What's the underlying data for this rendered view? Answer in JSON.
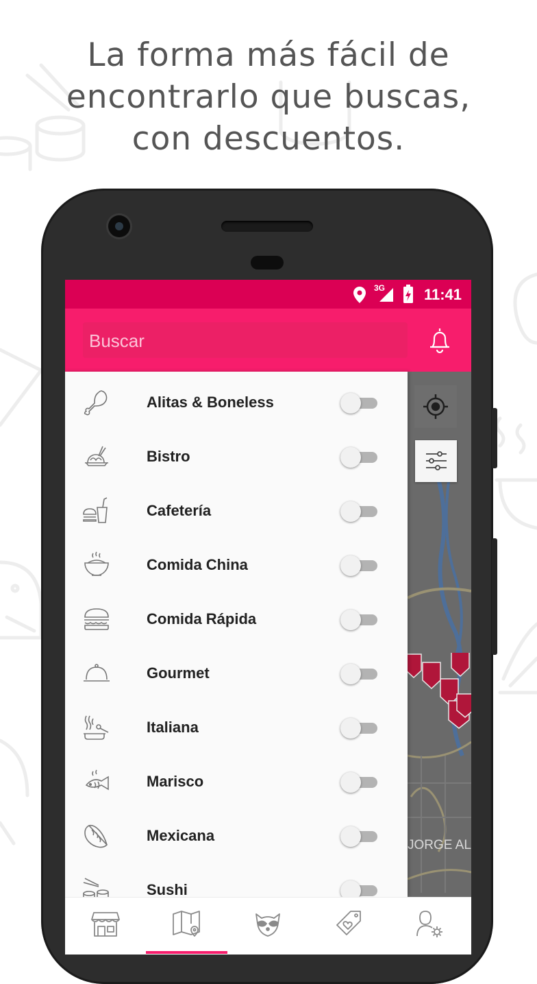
{
  "headline": {
    "line1": "La forma más fácil de",
    "line2": "encontrarlo que buscas,",
    "line3": "con descuentos."
  },
  "status_bar": {
    "network": "3G",
    "time": "11:41",
    "icons": [
      "location-icon",
      "signal-icon",
      "battery-icon"
    ]
  },
  "app_bar": {
    "search_placeholder": "Buscar",
    "notifications_icon": "bell-icon"
  },
  "map": {
    "street_label": "JORGE AL",
    "buttons": [
      "my-location-icon",
      "filter-sliders-icon"
    ]
  },
  "categories": [
    {
      "label": "Alitas & Boneless",
      "icon": "chicken-leg-icon",
      "enabled": false
    },
    {
      "label": "Bistro",
      "icon": "bistro-plate-icon",
      "enabled": false
    },
    {
      "label": "Cafetería",
      "icon": "burger-drink-icon",
      "enabled": false
    },
    {
      "label": "Comida China",
      "icon": "rice-bowl-icon",
      "enabled": false
    },
    {
      "label": "Comida Rápida",
      "icon": "burger-icon",
      "enabled": false
    },
    {
      "label": "Gourmet",
      "icon": "cloche-icon",
      "enabled": false
    },
    {
      "label": "Italiana",
      "icon": "pasta-pot-icon",
      "enabled": false
    },
    {
      "label": "Marisco",
      "icon": "fish-icon",
      "enabled": false
    },
    {
      "label": "Mexicana",
      "icon": "taco-icon",
      "enabled": false
    },
    {
      "label": "Sushi",
      "icon": "sushi-icon",
      "enabled": false
    }
  ],
  "bottom_nav": {
    "items": [
      "store-icon",
      "map-icon",
      "raccoon-icon",
      "heart-tag-icon",
      "user-settings-icon"
    ],
    "active_index": 1
  },
  "colors": {
    "status_bar": "#db0054",
    "app_bar": "#f71d6c",
    "accent": "#f71d6c",
    "map_pin": "#b0163a"
  }
}
